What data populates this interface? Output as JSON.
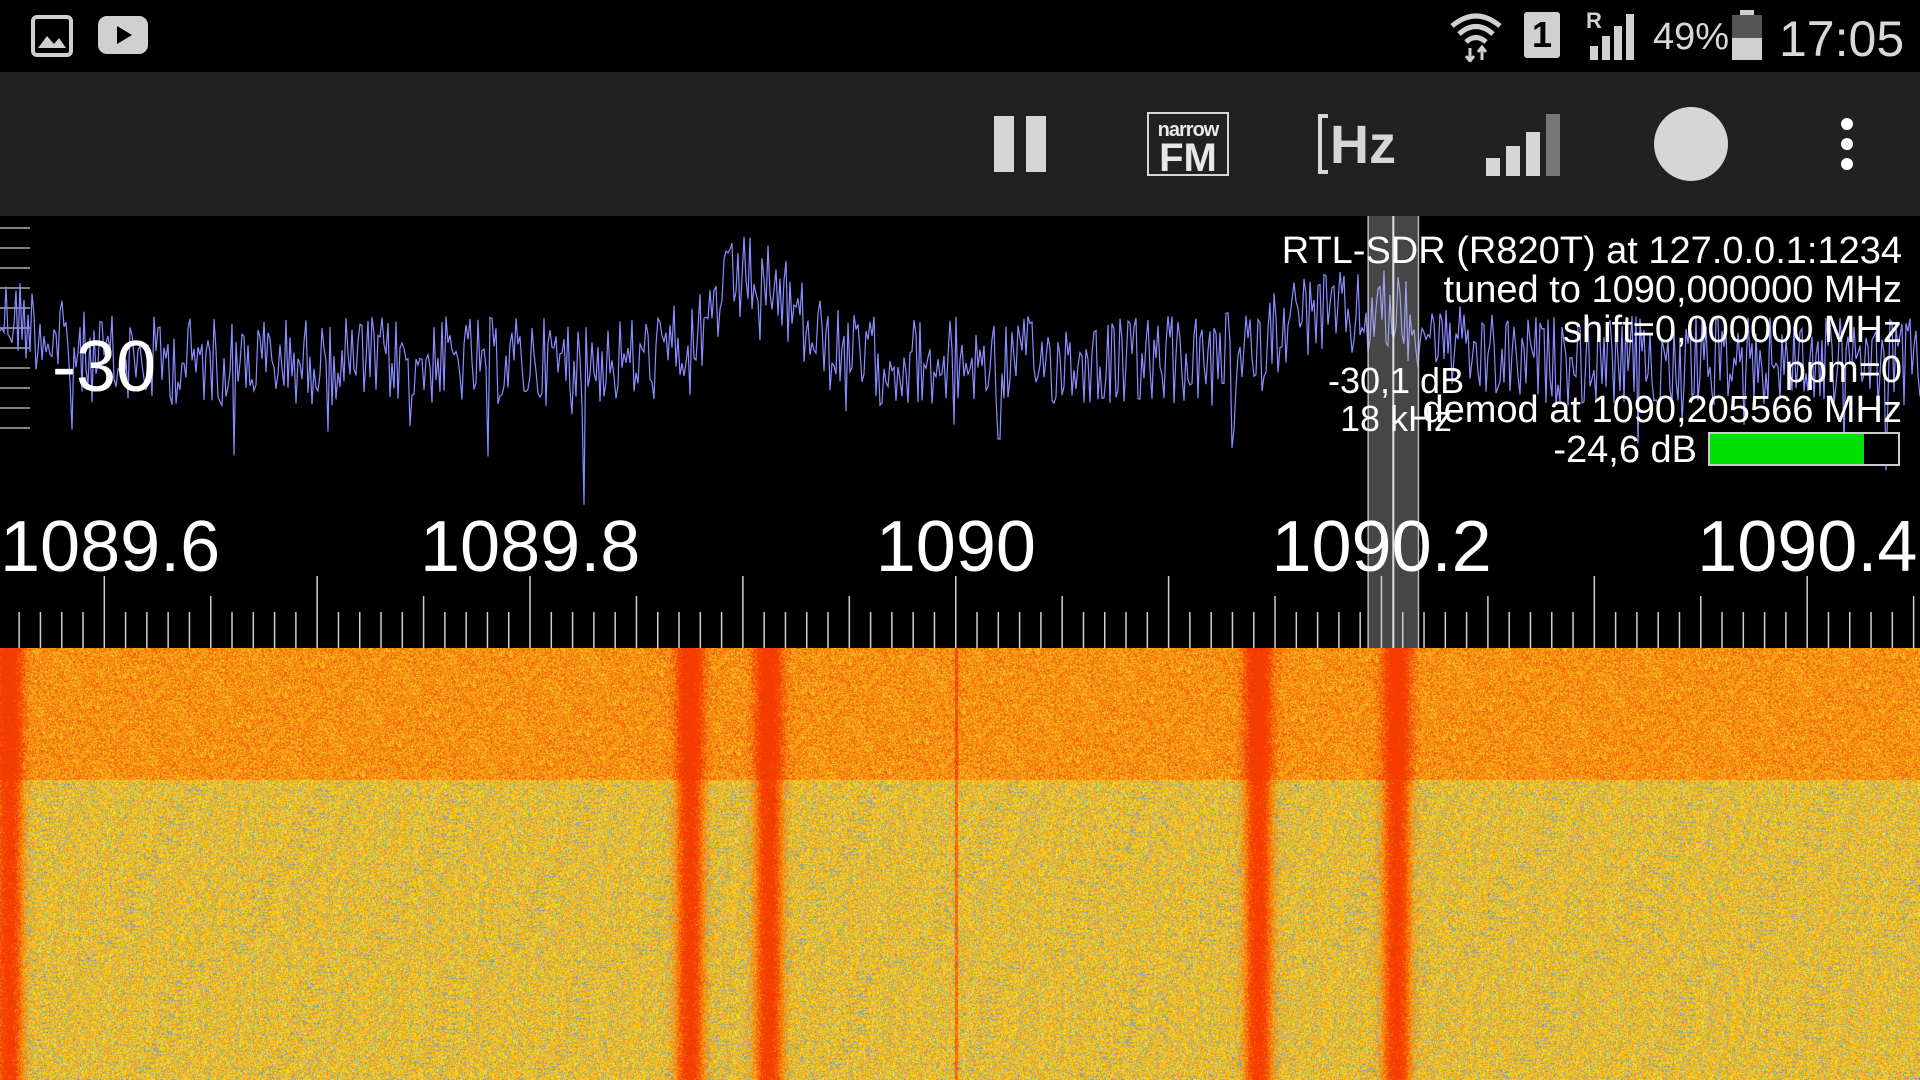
{
  "status_bar": {
    "left_icons": [
      "gallery-icon",
      "youtube-icon"
    ],
    "right_icons": [
      "wifi-icon",
      "sim-1-icon",
      "signal-roaming-icon",
      "battery-icon"
    ],
    "sim_label": "1",
    "roaming_label": "R",
    "battery_percent": "49%",
    "battery_level": 0.49,
    "time": "17:05"
  },
  "toolbar": {
    "buttons": [
      {
        "name": "pause-button",
        "icon": "pause-icon"
      },
      {
        "name": "narrow-fm-button",
        "icon": "narrow-fm-icon",
        "top_text": "narrow",
        "bottom_text": "FM"
      },
      {
        "name": "frequency-unit-button",
        "icon": "hz-bracket-icon",
        "text": "Hz"
      },
      {
        "name": "gain-button",
        "icon": "signal-bars-icon"
      },
      {
        "name": "record-button",
        "icon": "record-icon"
      },
      {
        "name": "overflow-menu-button",
        "icon": "more-vertical-icon"
      }
    ]
  },
  "spectrum": {
    "device_line": "RTL-SDR (R820T) at 127.0.0.1:1234",
    "tuned_line": "tuned to 1090,000000 MHz",
    "shift_line": "shift=0,000000 MHz",
    "ppm_line": "ppm=0",
    "demod_line": "demod at 1090,205566 MHz",
    "level_line": "-24,6 dB",
    "signal_level": 0.82,
    "db_scale_label": "-30",
    "marker_db": "-30,1 dB",
    "marker_bw": "18 kHz",
    "freq_labels": [
      "1089.6",
      "1089.8",
      "1090",
      "1090.2",
      "1090.4"
    ],
    "freq_range_mhz": [
      1089.551,
      1090.453
    ],
    "marker_center_mhz": 1090.205566,
    "marker_bandwidth_khz": 18,
    "trace_color": "#8a8cff",
    "colors": {
      "toolbar_bg": "#212121",
      "waterfall_base": "#f5e020",
      "waterfall_hot": "#e85010",
      "level_fill": "#00e000"
    }
  }
}
